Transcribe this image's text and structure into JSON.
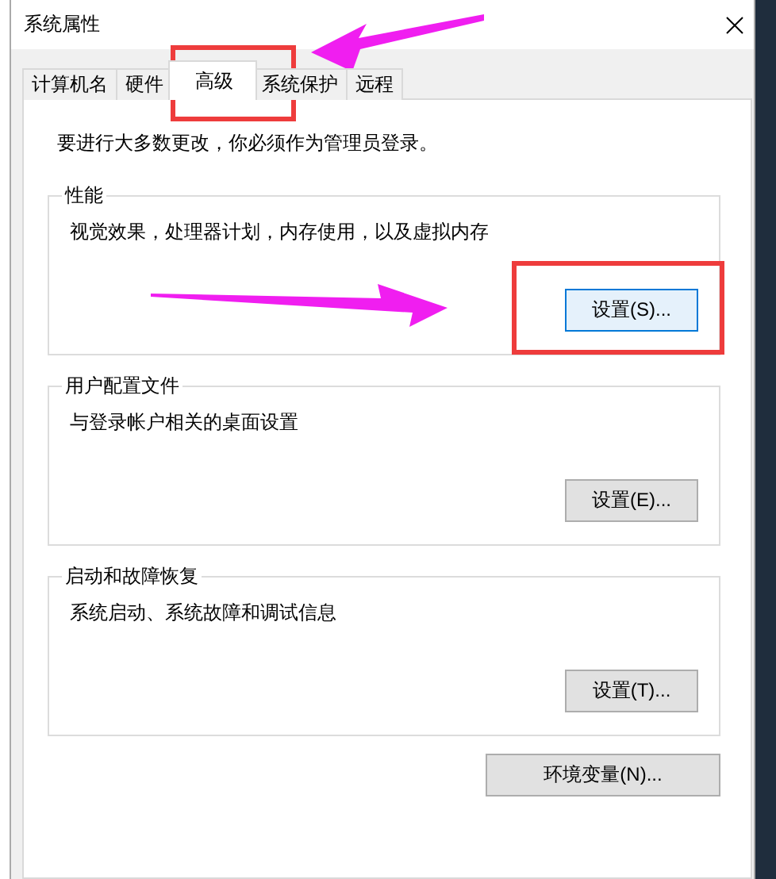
{
  "window": {
    "title": "系统属性"
  },
  "tabs": [
    {
      "label": "计算机名",
      "selected": false
    },
    {
      "label": "硬件",
      "selected": false
    },
    {
      "label": "高级",
      "selected": true
    },
    {
      "label": "系统保护",
      "selected": false
    },
    {
      "label": "远程",
      "selected": false
    }
  ],
  "notice": "要进行大多数更改，你必须作为管理员登录。",
  "groups": [
    {
      "title": "性能",
      "description": "视觉效果，处理器计划，内存使用，以及虚拟内存",
      "button": {
        "label": "设置(S)...",
        "focused": true
      }
    },
    {
      "title": "用户配置文件",
      "description": "与登录帐户相关的桌面设置",
      "button": {
        "label": "设置(E)...",
        "focused": false
      }
    },
    {
      "title": "启动和故障恢复",
      "description": "系统启动、系统故障和调试信息",
      "button": {
        "label": "设置(T)...",
        "focused": false
      }
    }
  ],
  "env_button": {
    "label": "环境变量(N)...",
    "focused": false
  },
  "annotations": [
    {
      "kind": "box"
    },
    {
      "kind": "arrow"
    },
    {
      "kind": "box"
    },
    {
      "kind": "arrow"
    }
  ]
}
